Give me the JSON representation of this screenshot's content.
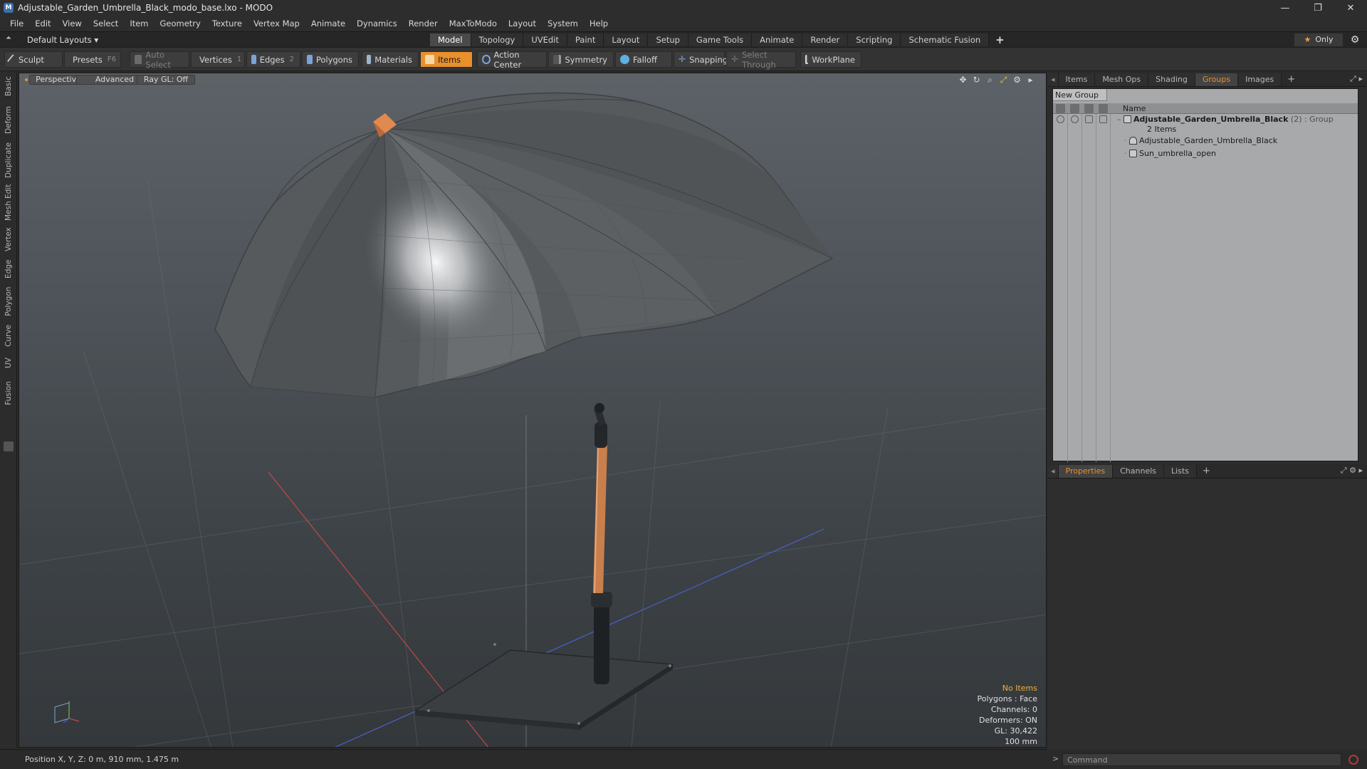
{
  "window": {
    "title": "Adjustable_Garden_Umbrella_Black_modo_base.lxo - MODO",
    "controls": [
      "—",
      "❐",
      "✕"
    ]
  },
  "menu": [
    "File",
    "Edit",
    "View",
    "Select",
    "Item",
    "Geometry",
    "Texture",
    "Vertex Map",
    "Animate",
    "Dynamics",
    "Render",
    "MaxToModo",
    "Layout",
    "System",
    "Help"
  ],
  "layoutbar": {
    "layout_name": "Default Layouts ▾",
    "tabs": [
      "Model",
      "Topology",
      "UVEdit",
      "Paint",
      "Layout",
      "Setup",
      "Game Tools",
      "Animate",
      "Render",
      "Scripting",
      "Schematic Fusion"
    ],
    "active_tab": "Model",
    "plus": "+",
    "only_label": "Only",
    "star": "★",
    "gear": "⚙"
  },
  "toolbar": {
    "sculpt": "Sculpt",
    "presets": "Presets",
    "presets_key": "F6",
    "auto_select": "Auto Select",
    "vertices": "Vertices",
    "vertices_key": "1",
    "edges": "Edges",
    "edges_key": "2",
    "polygons": "Polygons",
    "materials": "Materials",
    "items": "Items",
    "action_center": "Action Center",
    "symmetry": "Symmetry",
    "falloff": "Falloff",
    "snapping": "Snapping",
    "select_through": "Select Through",
    "workplane": "WorkPlane"
  },
  "left_tabs": [
    "Basic",
    "Deform",
    "Duplicate",
    "Mesh Edit",
    "Vertex",
    "Edge",
    "Polygon",
    "Curve",
    "UV",
    "Fusion"
  ],
  "viewport": {
    "view_mode": "Perspective",
    "shading": "Advanced",
    "raygl": "Ray GL: Off",
    "info": {
      "selection": "No Items",
      "polygons": "Polygons : Face",
      "channels": "Channels: 0",
      "deformers": "Deformers: ON",
      "gl": "GL: 30,422",
      "scale": "100 mm"
    }
  },
  "status": {
    "position": "Position X, Y, Z:  0 m, 910 mm, 1.475 m"
  },
  "top_panel": {
    "tabs": [
      "Items",
      "Mesh Ops",
      "Shading",
      "Groups",
      "Images"
    ],
    "active_tab": "Groups",
    "plus": "+",
    "new_group": "New Group",
    "name_col": "Name",
    "group": {
      "name": "Adjustable_Garden_Umbrella_Black",
      "count_suffix": "(2) : Group",
      "items_label": "2 Items",
      "children": [
        "Adjustable_Garden_Umbrella_Black",
        "Sun_umbrella_open"
      ]
    }
  },
  "bottom_panel": {
    "tabs": [
      "Properties",
      "Channels",
      "Lists"
    ],
    "active_tab": "Properties",
    "plus": "+"
  },
  "command": {
    "placeholder": "Command"
  },
  "colors": {
    "accent": "#e8902c",
    "viewport_top": "#5c6267",
    "viewport_bottom": "#34383b",
    "canopy": "#5a5d60",
    "pole": "#c87f4c"
  }
}
